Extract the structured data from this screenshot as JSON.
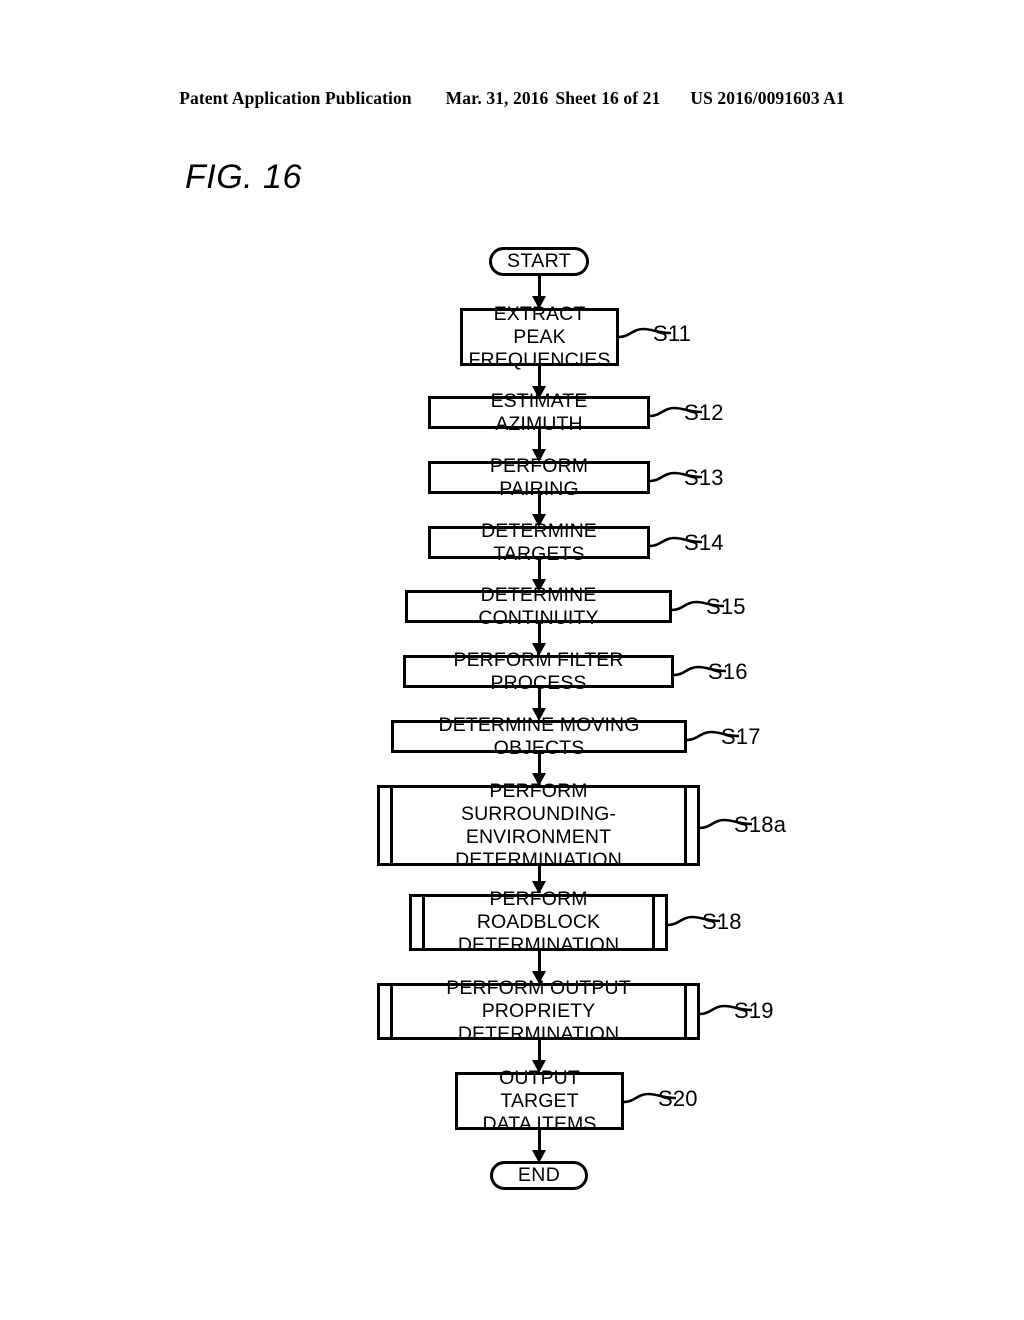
{
  "header": {
    "publication": "Patent Application Publication",
    "date": "Mar. 31, 2016",
    "sheet": "Sheet 16 of 21",
    "patent_number": "US 2016/0091603 A1"
  },
  "figure": {
    "label": "FIG. 16"
  },
  "flowchart": {
    "start_label": "START",
    "end_label": "END",
    "steps": [
      {
        "id": "S11",
        "text": "EXTRACT PEAK\nFREQUENCIES",
        "shape": "process"
      },
      {
        "id": "S12",
        "text": "ESTIMATE AZIMUTH",
        "shape": "process"
      },
      {
        "id": "S13",
        "text": "PERFORM PAIRING",
        "shape": "process"
      },
      {
        "id": "S14",
        "text": "DETERMINE TARGETS",
        "shape": "process"
      },
      {
        "id": "S15",
        "text": "DETERMINE CONTINUITY",
        "shape": "process"
      },
      {
        "id": "S16",
        "text": "PERFORM FILTER PROCESS",
        "shape": "process"
      },
      {
        "id": "S17",
        "text": "DETERMINE MOVING OBJECTS",
        "shape": "process"
      },
      {
        "id": "S18a",
        "text": "PERFORM\nSURROUNDING-ENVIRONMENT\nDETERMINIATION",
        "shape": "predefined-process"
      },
      {
        "id": "S18",
        "text": "PERFORM ROADBLOCK\nDETERMINATION",
        "shape": "predefined-process"
      },
      {
        "id": "S19",
        "text": "PERFORM OUTPUT PROPRIETY\nDETERMINATION",
        "shape": "predefined-process"
      },
      {
        "id": "S20",
        "text": "OUTPUT TARGET\nDATA ITEMS",
        "shape": "process"
      }
    ]
  },
  "colors": {
    "ink": "#000000",
    "paper": "#ffffff"
  }
}
